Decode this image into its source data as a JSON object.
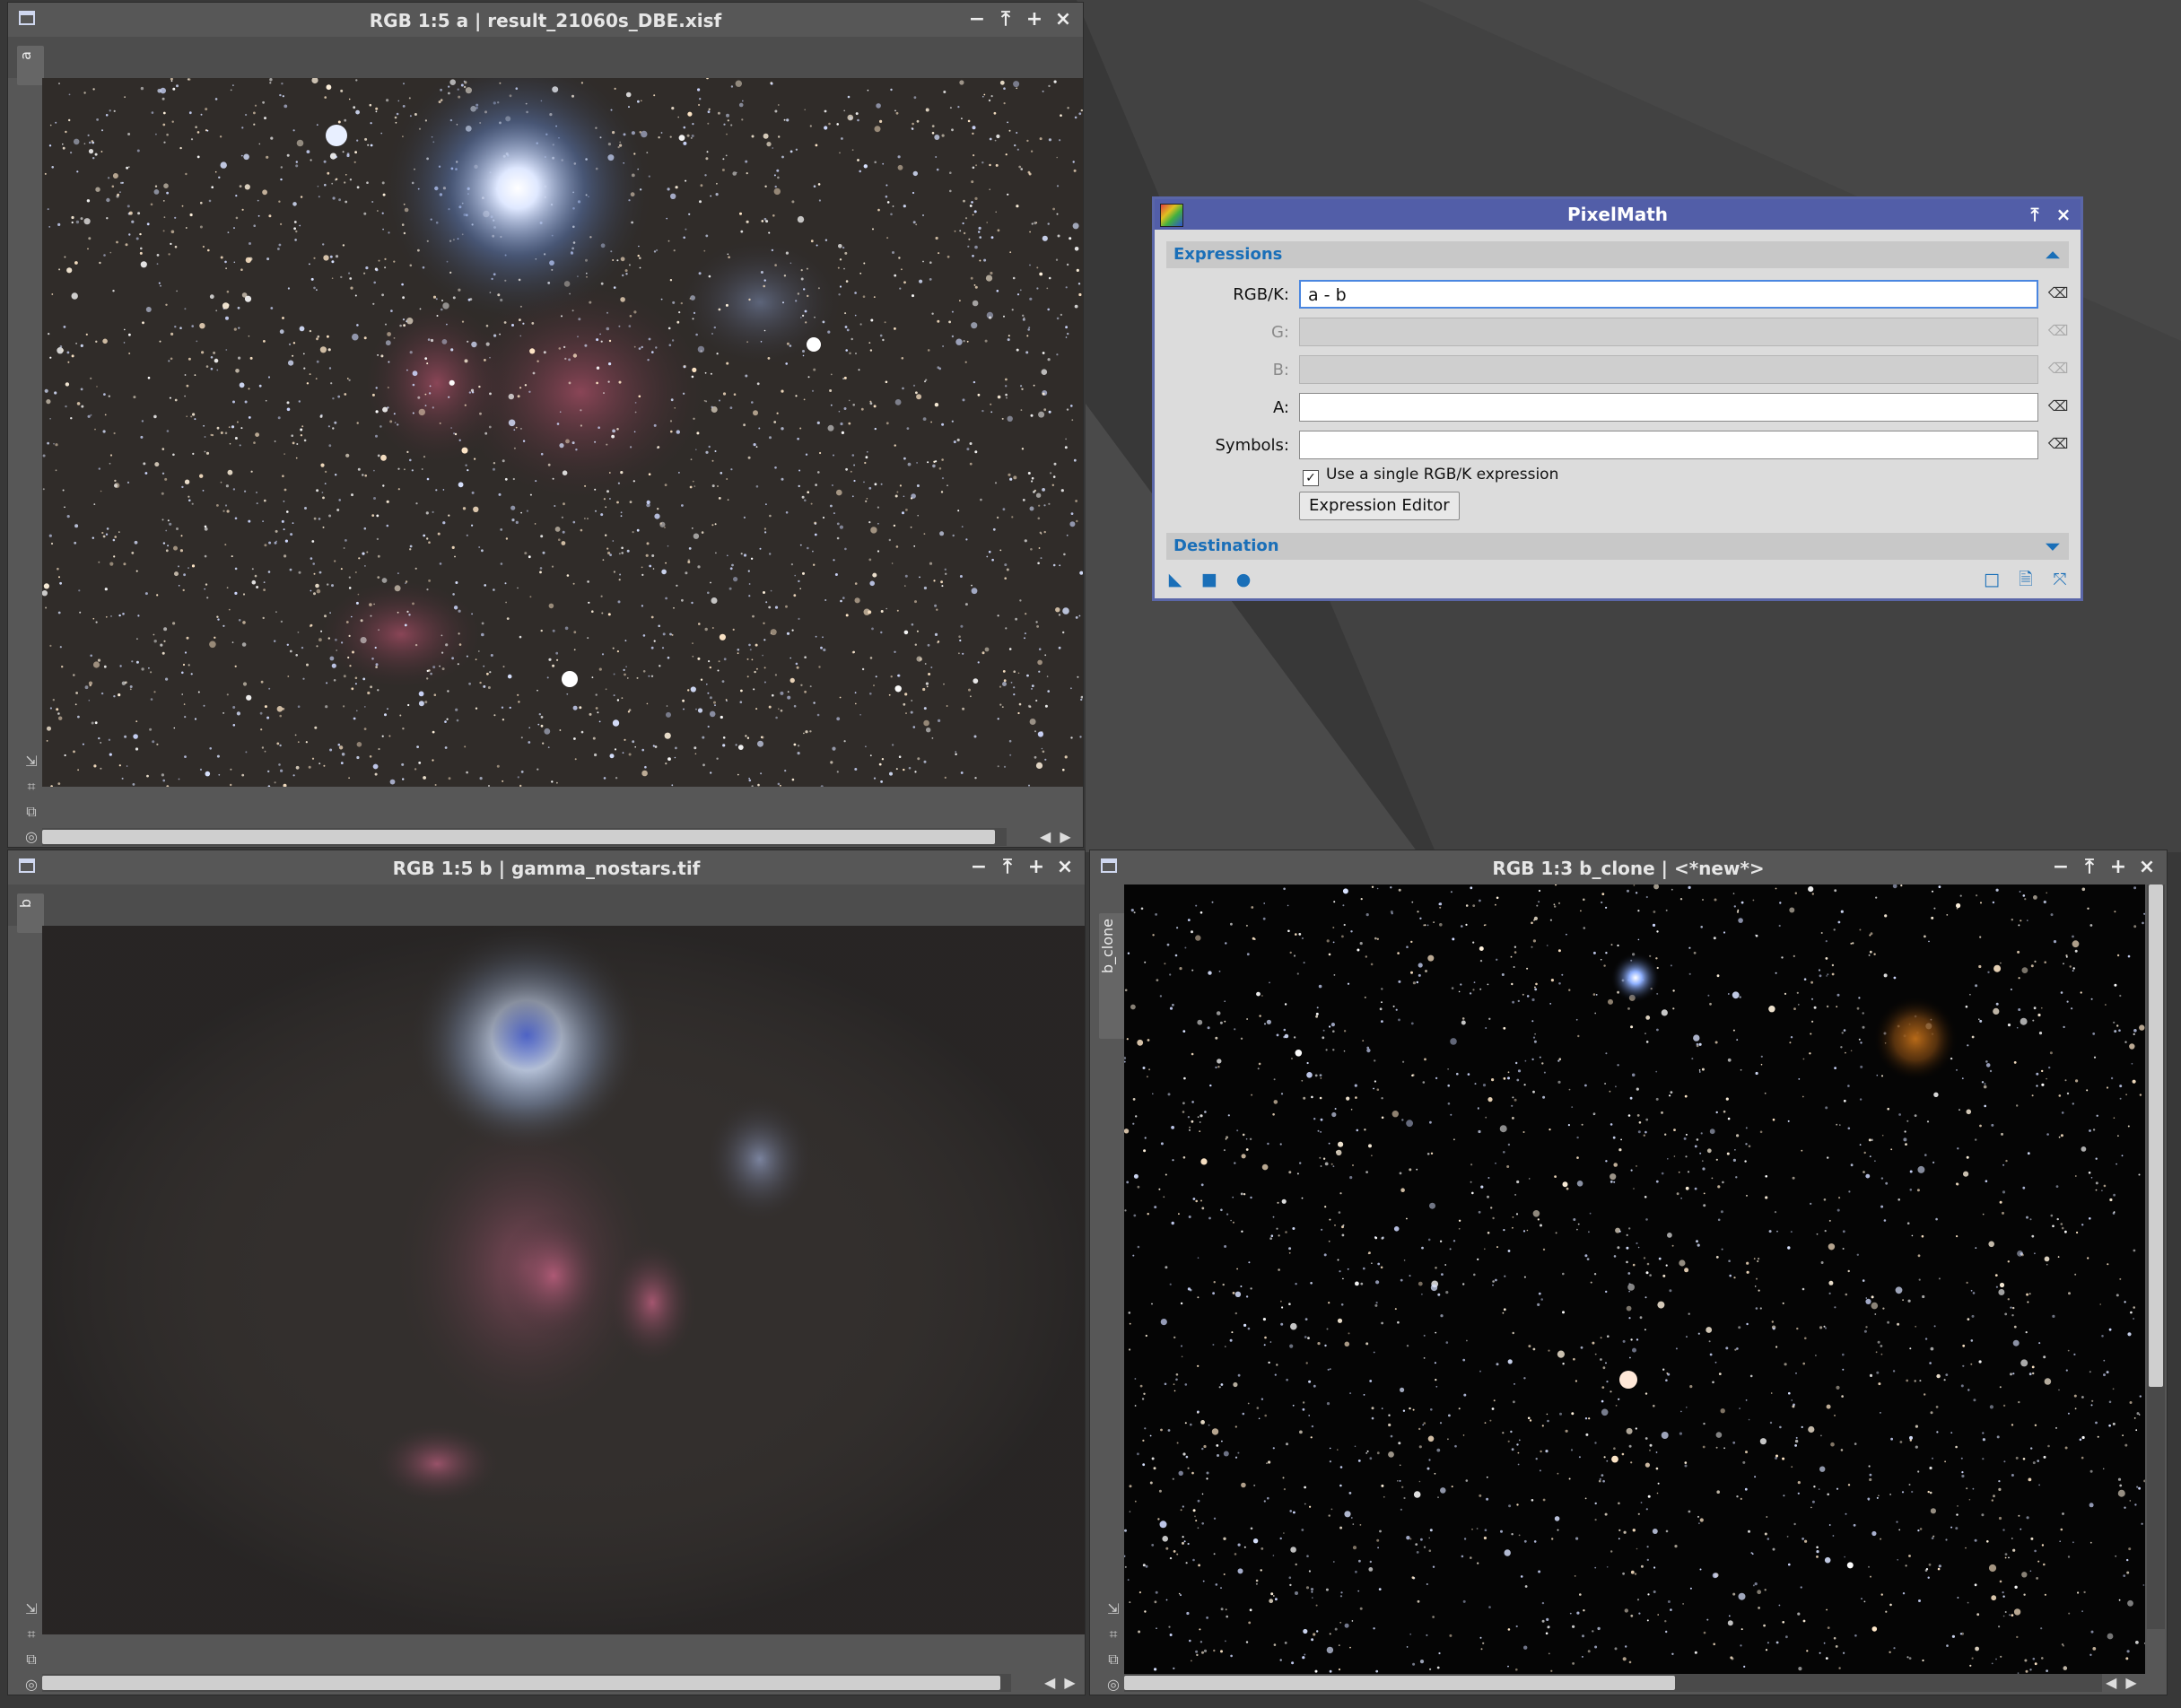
{
  "windows": {
    "a": {
      "title": "RGB 1:5 a | result_21060s_DBE.xisf",
      "tab": "a"
    },
    "b": {
      "title": "RGB 1:5 b | gamma_nostars.tif",
      "tab": "b"
    },
    "b_clone": {
      "title": "RGB 1:3 b_clone | <*new*>",
      "tab": "b_clone"
    }
  },
  "window_buttons": {
    "minimize": "−",
    "shade": "⤒",
    "maximize": "+",
    "close": "×"
  },
  "pixelmath": {
    "title": "PixelMath",
    "expressions_section": "Expressions",
    "rgbk_label": "RGB/K:",
    "rgbk_value": "a - b",
    "g_label": "G:",
    "g_value": "",
    "b_label": "B:",
    "b_value": "",
    "a_label": "A:",
    "a_value": "",
    "symbols_label": "Symbols:",
    "symbols_value": "",
    "use_single_label": "Use a single RGB/K expression",
    "use_single_checked": true,
    "expression_editor_label": "Expression Editor",
    "destination_section": "Destination"
  },
  "colors": {
    "accent": "#1a6fb8",
    "dialog_title": "#525ea8",
    "workspace": "#3a3a3a",
    "window_frame": "#575757"
  }
}
